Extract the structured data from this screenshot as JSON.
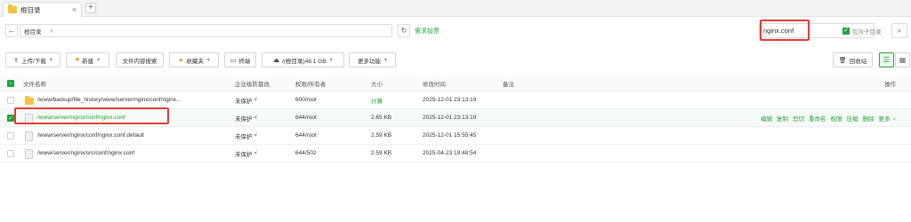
{
  "tab": {
    "title": "根目录",
    "close_icon": "×"
  },
  "tab_add": "+",
  "address": {
    "back_icon": "←",
    "path_root": "根目录",
    "path_arrow": "›",
    "refresh_icon": "↻",
    "favorite_label": "需求投票"
  },
  "search": {
    "value": "nginx.conf",
    "include_subdir_label": "包含子目录",
    "search_icon": "⌕"
  },
  "toolbar": {
    "upload_label": "上传/下载",
    "new_label": "新建",
    "content_search_label": "文件内容搜索",
    "favorites_label": "收藏夹",
    "terminal_label": "终端",
    "disk_label": "/(根目录)48.1 GB",
    "more_label": "更多功能",
    "recycle_label": "回收站"
  },
  "table": {
    "headers": {
      "name": "文件名称",
      "protect": "企业级防篡改",
      "perm": "权限/所有者",
      "size": "大小",
      "mtime": "修改时间",
      "note": "备注",
      "actions": "操作"
    },
    "rows": [
      {
        "name": "/www/backup/file_history/www/server/nginx/conf/nginx...",
        "protect": "未保护",
        "perm": "600/root",
        "size": "计算",
        "mtime": "2025-12-01 23:13:19",
        "type": "folder"
      },
      {
        "name": "/www/server/nginx/conf/nginx.conf",
        "protect": "未保护",
        "perm": "644/root",
        "size": "2.65 KB",
        "mtime": "2025-12-01 23:13:19",
        "type": "file"
      },
      {
        "name": "/www/server/nginx/conf/nginx.conf.default",
        "protect": "未保护",
        "perm": "644/root",
        "size": "2.59 KB",
        "mtime": "2025-12-01 15:55:45",
        "type": "file"
      },
      {
        "name": "/www/server/nginx/src/conf/nginx.conf",
        "protect": "未保护",
        "perm": "644/502",
        "size": "2.59 KB",
        "mtime": "2025-04-23 19:48:54",
        "type": "file"
      }
    ],
    "row_actions": [
      "编辑",
      "复制",
      "剪切",
      "重命名",
      "权限",
      "压缩",
      "删除",
      "更多"
    ]
  },
  "colors": {
    "accent": "#20a53a",
    "highlight": "#e33b3b",
    "folder": "#f6c244"
  }
}
